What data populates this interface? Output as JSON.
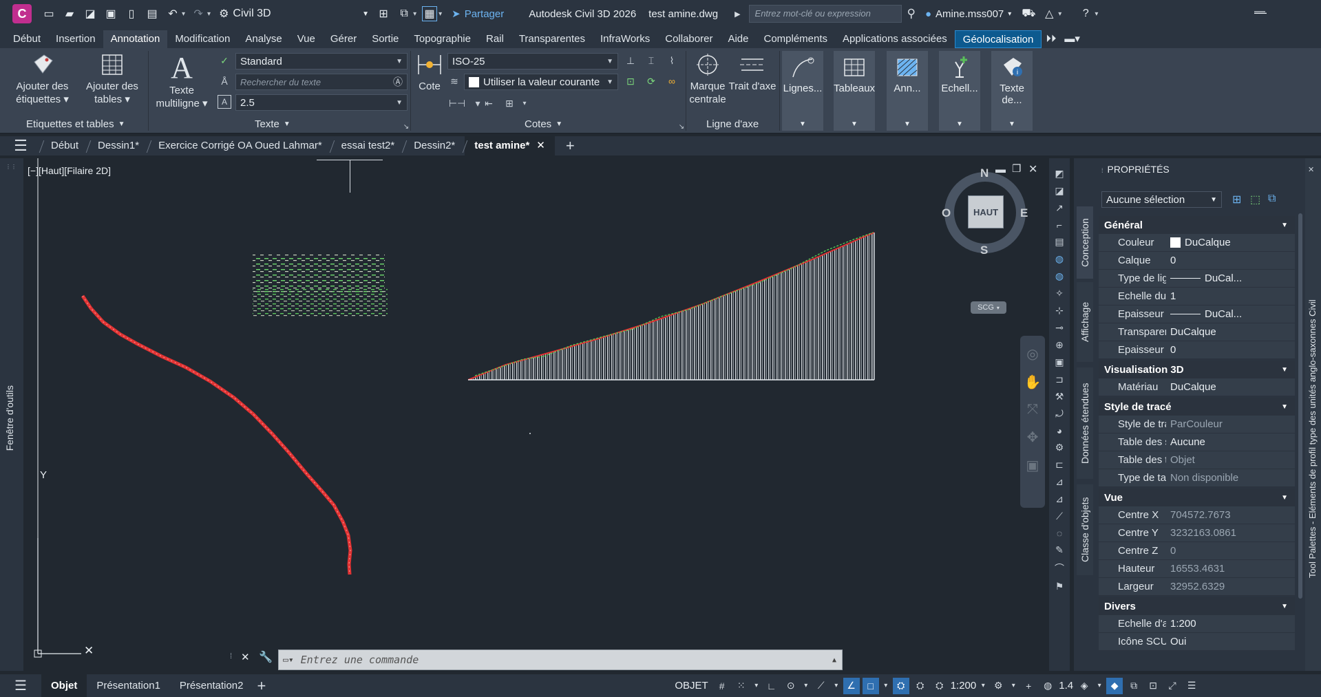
{
  "titlebar": {
    "app_badge": "C",
    "workspace": "Civil 3D",
    "share_label": "Partager",
    "app_title": "Autodesk Civil 3D 2026",
    "file_name": "test amine.dwg",
    "search_placeholder": "Entrez mot-clé ou expression",
    "user_name": "Amine.mss007"
  },
  "ribbon_tabs": [
    "Début",
    "Insertion",
    "Annotation",
    "Modification",
    "Analyse",
    "Vue",
    "Gérer",
    "Sortie",
    "Topographie",
    "Rail",
    "Transparentes",
    "InfraWorks",
    "Collaborer",
    "Aide",
    "Compléments",
    "Applications associées",
    "Géolocalisation"
  ],
  "ribbon": {
    "labels_tables": {
      "add_labels": "Ajouter des étiquettes",
      "add_tables": "Ajouter des tables",
      "panel_label": "Etiquettes et tables"
    },
    "text": {
      "mtext": "Texte multiligne",
      "style": "Standard",
      "search_placeholder": "Rechercher du texte",
      "height": "2.5",
      "panel_label": "Texte"
    },
    "dims": {
      "cote": "Cote",
      "style": "ISO-25",
      "layer": "Utiliser la valeur courante",
      "panel_label": "Cotes"
    },
    "centerline": {
      "center_mark": "Marque centrale",
      "center_line": "Trait d'axe",
      "panel_label": "Ligne d'axe"
    },
    "tiles": [
      "Lignes...",
      "Tableaux",
      "Ann...",
      "Echell...",
      "Texte de..."
    ]
  },
  "file_tabs": [
    "Début",
    "Dessin1*",
    "Exercice Corrigé OA Oued Lahmar*",
    "essai test2*",
    "Dessin2*",
    "test amine*"
  ],
  "viewport": {
    "label": "[−][Haut][Filaire 2D]",
    "compass": {
      "n": "N",
      "s": "S",
      "e": "E",
      "w": "O",
      "cube": "HAUT"
    },
    "ucs_label": "SCG",
    "axis_y": "Y",
    "axis_x": "X",
    "left_strip": "Fenêtre d'outils"
  },
  "command": {
    "placeholder": "Entrez une commande"
  },
  "properties": {
    "title": "PROPRIÉTÉS",
    "selection": "Aucune sélection",
    "side_tabs": [
      "Conception",
      "Affichage",
      "Données étendues",
      "Classe d'objets"
    ],
    "right_strip": "Tool Palettes - Eléments de profil type des unités anglo-saxonnes Civil",
    "sections": [
      {
        "name": "Général",
        "rows": [
          {
            "k": "Couleur",
            "v": "DuCalque"
          },
          {
            "k": "Calque",
            "v": "0"
          },
          {
            "k": "Type de ligne",
            "v": "DuCal..."
          },
          {
            "k": "Echelle du t...",
            "v": "1"
          },
          {
            "k": "Epaisseur d...",
            "v": "DuCal..."
          },
          {
            "k": "Transparence",
            "v": "DuCalque"
          },
          {
            "k": "Epaisseur",
            "v": "0"
          }
        ]
      },
      {
        "name": "Visualisation 3D",
        "rows": [
          {
            "k": "Matériau",
            "v": "DuCalque"
          }
        ]
      },
      {
        "name": "Style de tracé",
        "rows": [
          {
            "k": "Style de tracé",
            "v": "ParCouleur"
          },
          {
            "k": "Table des st...",
            "v": "Aucune"
          },
          {
            "k": "Table des tr...",
            "v": "Objet"
          },
          {
            "k": "Type de tab...",
            "v": "Non disponible"
          }
        ]
      },
      {
        "name": "Vue",
        "rows": [
          {
            "k": "Centre X",
            "v": "704572.7673"
          },
          {
            "k": "Centre Y",
            "v": "3232163.0861"
          },
          {
            "k": "Centre Z",
            "v": "0"
          },
          {
            "k": "Hauteur",
            "v": "16553.4631"
          },
          {
            "k": "Largeur",
            "v": "32952.6329"
          }
        ]
      },
      {
        "name": "Divers",
        "rows": [
          {
            "k": "Echelle d'an...",
            "v": "1:200"
          },
          {
            "k": "Icône SCU...",
            "v": "Oui"
          }
        ]
      }
    ]
  },
  "statusbar": {
    "layouts": [
      "Objet",
      "Présentation1",
      "Présentation2"
    ],
    "mode": "OBJET",
    "scale": "1:200",
    "lineweight": "1.4"
  }
}
